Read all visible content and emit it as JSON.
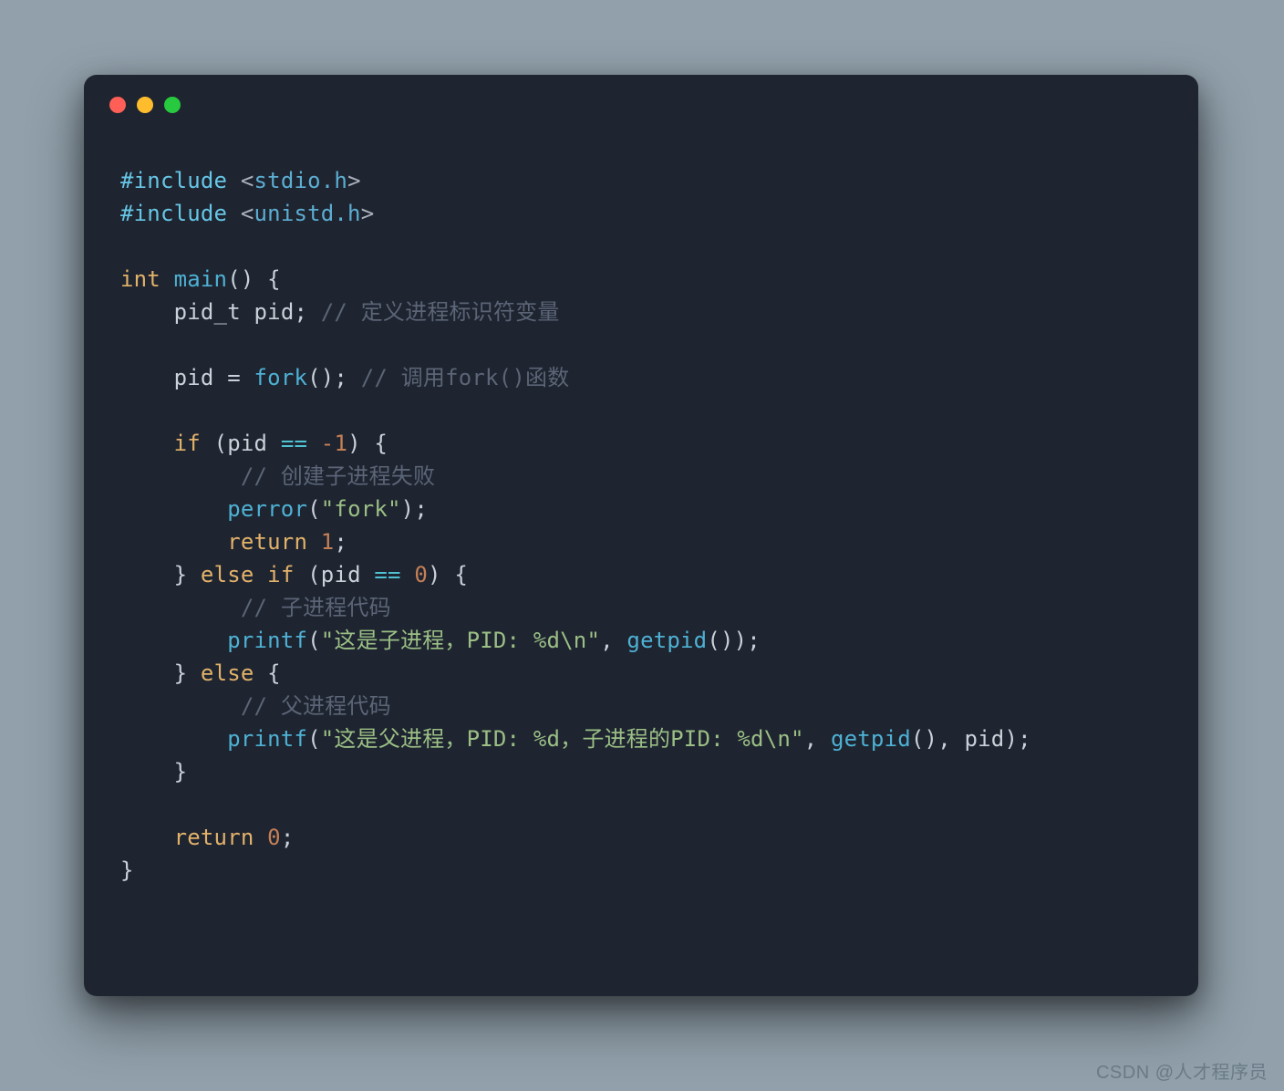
{
  "code": {
    "include1_directive": "#include",
    "include1_open": " <",
    "include1_hdr": "stdio.h",
    "include1_close": ">",
    "include2_directive": "#include",
    "include2_open": " <",
    "include2_hdr": "unistd.h",
    "include2_close": ">",
    "blank": "",
    "int_kw": "int",
    "space": " ",
    "main_fn": "main",
    "main_paren_open": "()",
    "space_brace": " {",
    "indent1": "    ",
    "indent2": "        ",
    "pid_t": "pid_t",
    "pid_id": "pid",
    "semi": ";",
    "cmt_slash": " // ",
    "cmt_def": "定义进程标识符变量",
    "pid_assign": "pid = ",
    "fork_fn": "fork",
    "parens_semi": "();",
    "cmt_fork": "调用fork()函数",
    "if_kw": "if",
    "if_open": " (",
    "eq_op": " == ",
    "neg1": "-1",
    "if_close_brace": ") {",
    "cmt_fail": "创建子进程失败",
    "perror_fn": "perror",
    "perror_arg_open": "(",
    "str_fork": "\"fork\"",
    "perror_arg_close": ");",
    "return_kw": "return",
    "num1": "1",
    "close_else_if": "} ",
    "else_kw": "else",
    "elseif_if": " if",
    "elseif_open": " (",
    "num0": "0",
    "elseif_close": ") {",
    "cmt_child": "子进程代码",
    "printf_fn": "printf",
    "printf_open": "(",
    "str_child": "\"这是子进程，PID: %d\\n\"",
    "comma_sp": ", ",
    "getpid_fn": "getpid",
    "getpid_call": "()",
    "printf_close": ");",
    "close_else": "} ",
    "else_brace": " {",
    "cmt_parent": "父进程代码",
    "str_parent": "\"这是父进程，PID: %d，子进程的PID: %d\\n\"",
    "close_brace": "}",
    "return0_num": "0",
    "final_close": "}"
  },
  "watermark": "CSDN @人才程序员"
}
